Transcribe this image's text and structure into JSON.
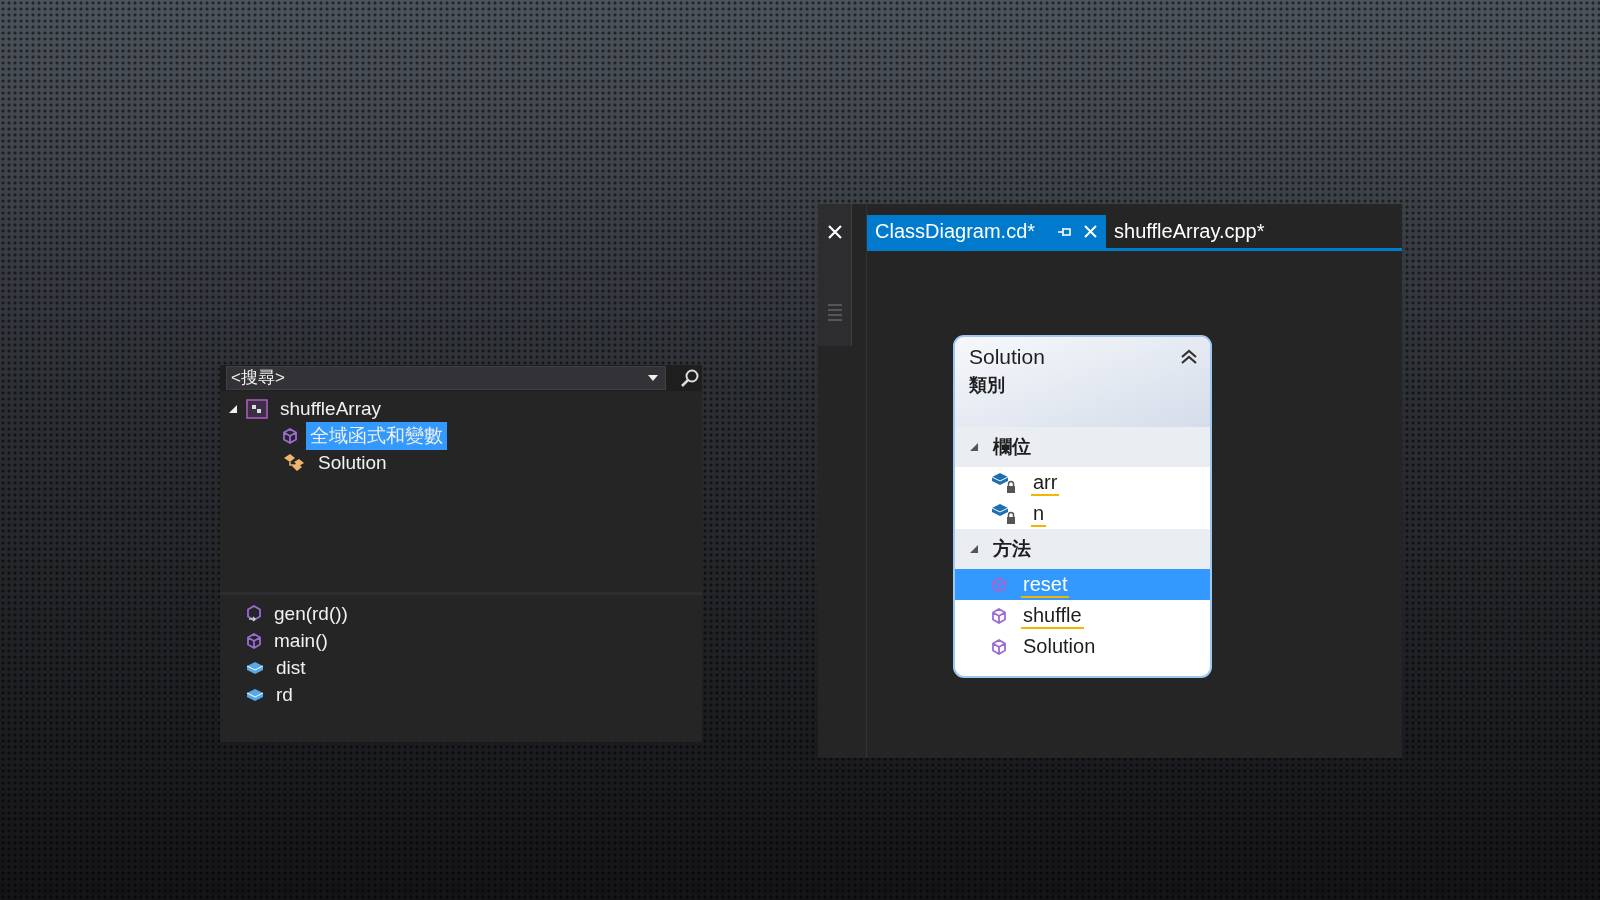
{
  "class_view": {
    "search": {
      "placeholder": "<搜尋>"
    },
    "tree": [
      {
        "label": "shuffleArray",
        "kind": "project",
        "expanded": true,
        "selected": false,
        "children": [
          {
            "label": "全域函式和變數",
            "kind": "globals",
            "selected": true
          },
          {
            "label": "Solution",
            "kind": "class",
            "selected": false
          }
        ]
      }
    ],
    "members": [
      {
        "label": "gen(rd())",
        "kind": "method-ref"
      },
      {
        "label": "main()",
        "kind": "method"
      },
      {
        "label": "dist",
        "kind": "field"
      },
      {
        "label": "rd",
        "kind": "field"
      }
    ]
  },
  "editor": {
    "tabs": [
      {
        "label": "ClassDiagram.cd*",
        "selected": true
      },
      {
        "label": "shuffleArray.cpp*",
        "selected": false
      }
    ],
    "class_shape": {
      "name": "Solution",
      "type": "類別",
      "sections": [
        {
          "title": "欄位",
          "expanded": true,
          "members": [
            {
              "name": "arr",
              "kind": "private-field",
              "selected": false,
              "squiggle": true
            },
            {
              "name": "n",
              "kind": "private-field",
              "selected": false,
              "squiggle": true
            }
          ]
        },
        {
          "title": "方法",
          "expanded": true,
          "members": [
            {
              "name": "reset",
              "kind": "method",
              "selected": true,
              "squiggle": true
            },
            {
              "name": "shuffle",
              "kind": "method",
              "selected": false,
              "squiggle": true
            },
            {
              "name": "Solution",
              "kind": "method",
              "selected": false,
              "squiggle": false
            }
          ]
        }
      ]
    }
  }
}
